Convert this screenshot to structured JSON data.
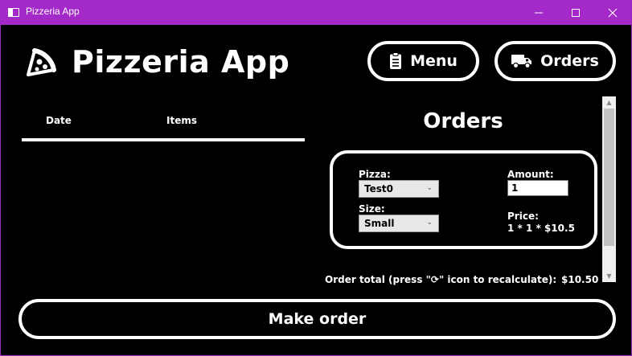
{
  "window": {
    "title": "Pizzeria App",
    "accent_color": "#a32ac9"
  },
  "header": {
    "app_title": "Pizzeria App",
    "menu_label": "Menu",
    "orders_label": "Orders"
  },
  "orders_list": {
    "columns": [
      "Date",
      "Items"
    ],
    "rows": []
  },
  "order_form": {
    "heading": "Orders",
    "pizza_label": "Pizza:",
    "pizza_value": "Test0",
    "size_label": "Size:",
    "size_value": "Small",
    "amount_label": "Amount:",
    "amount_value": "1",
    "price_label": "Price:",
    "price_value": "1 * 1 * $10.5",
    "total_label": "Order total (press \"⟳\" icon to recalculate):",
    "total_value": "$10.50"
  },
  "footer": {
    "make_order_label": "Make order"
  },
  "icons": {
    "logo": "pizza-slice-icon",
    "menu": "clipboard-list-icon",
    "orders": "delivery-truck-icon"
  }
}
